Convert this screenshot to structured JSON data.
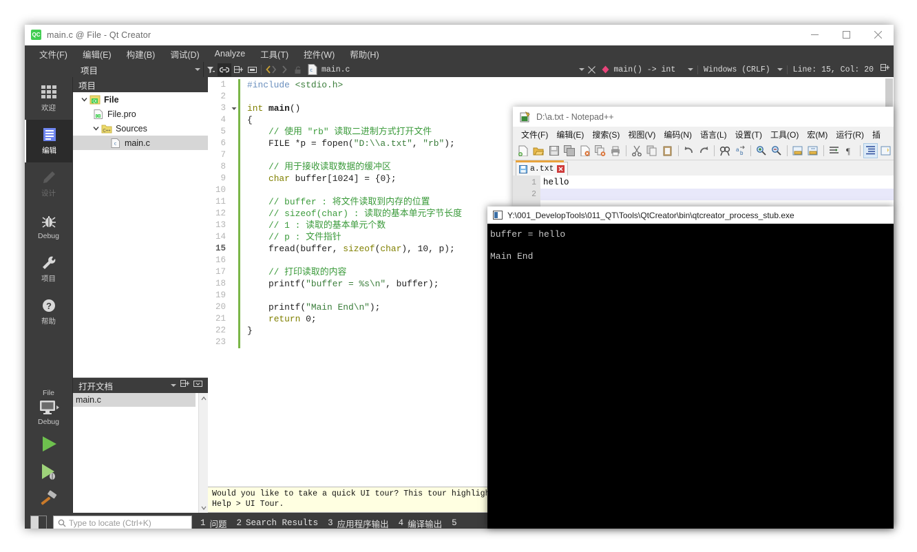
{
  "qtcreator": {
    "title": "main.c @ File - Qt Creator",
    "app_icon": "qt-creator-icon",
    "window_controls": {
      "minimize": "minimize-icon",
      "maximize": "maximize-icon",
      "close": "close-icon"
    },
    "menus": [
      {
        "label": "文件(F)"
      },
      {
        "label": "编辑(E)"
      },
      {
        "label": "构建(B)"
      },
      {
        "label": "调试(D)"
      },
      {
        "label": "Analyze"
      },
      {
        "label": "工具(T)"
      },
      {
        "label": "控件(W)"
      },
      {
        "label": "帮助(H)"
      }
    ],
    "toolbar": {
      "project_combo": "项目",
      "filter_icon": "filter-icon",
      "link_icon": "link-with-editor-icon",
      "split_icon": "add-split-icon",
      "collapse_icon": "collapse-icon",
      "nav_back_icon": "go-back-icon",
      "nav_forward_icon": "go-forward-icon",
      "lock_icon": "unlock-icon",
      "document_name": "main.c",
      "document_icon": "c-file-icon",
      "close_doc_icon": "close-document-icon",
      "symbol_name": "main() -> int",
      "symbol_icon": "function-symbol-icon",
      "eol_setting": "Windows (CRLF)",
      "line_col": "Line: 15, Col: 20",
      "split_editor_icon": "split-editor-icon"
    },
    "modes": [
      {
        "label": "欢迎",
        "icon": "welcome-grid-icon",
        "state": "normal"
      },
      {
        "label": "编辑",
        "icon": "edit-lines-icon",
        "state": "selected"
      },
      {
        "label": "设计",
        "icon": "design-pencil-icon",
        "state": "disabled"
      },
      {
        "label": "Debug",
        "icon": "debug-bug-icon",
        "state": "normal"
      },
      {
        "label": "项目",
        "icon": "projects-wrench-icon",
        "state": "normal"
      },
      {
        "label": "帮助",
        "icon": "help-question-icon",
        "state": "normal"
      }
    ],
    "run_section": {
      "kit_label": "File",
      "target_icon": "target-selector-icon",
      "build_config": "Debug",
      "run_icon": "run-play-icon",
      "debug_icon": "start-debugging-icon",
      "build_icon": "build-hammer-icon"
    },
    "project_dock": {
      "title": "项目",
      "tree": [
        {
          "label": "File",
          "icon": "qt-project-icon",
          "indent": 0,
          "expander": "expanded",
          "bold": true,
          "selected": false
        },
        {
          "label": "File.pro",
          "icon": "qt-pro-file-icon",
          "indent": 1,
          "expander": "none",
          "bold": false,
          "selected": false
        },
        {
          "label": "Sources",
          "icon": "cpp-folder-icon",
          "indent": 1,
          "expander": "expanded",
          "bold": false,
          "selected": false
        },
        {
          "label": "main.c",
          "icon": "c-file-icon",
          "indent": 2,
          "expander": "none",
          "bold": false,
          "selected": true
        }
      ]
    },
    "opendocs_dock": {
      "title": "打开文档",
      "items": [
        {
          "label": "main.c",
          "selected": true
        }
      ]
    },
    "editor": {
      "current_line": 15,
      "total_lines": 23,
      "lines": [
        {
          "n": 1,
          "fold": "none",
          "tokens": [
            {
              "t": "#include ",
              "c": "k-pre"
            },
            {
              "t": "<stdio.h>",
              "c": "k-inc"
            }
          ]
        },
        {
          "n": 2,
          "fold": "none",
          "tokens": []
        },
        {
          "n": 3,
          "fold": "expanded",
          "tokens": [
            {
              "t": "int ",
              "c": "k-type"
            },
            {
              "t": "main",
              "c": "k-fn"
            },
            {
              "t": "()",
              "c": "k-id"
            }
          ]
        },
        {
          "n": 4,
          "fold": "none",
          "tokens": [
            {
              "t": "{",
              "c": "k-id"
            }
          ]
        },
        {
          "n": 5,
          "fold": "none",
          "tokens": [
            {
              "t": "    // 使用 \"rb\" 读取二进制方式打开文件",
              "c": "k-cmt"
            }
          ]
        },
        {
          "n": 6,
          "fold": "none",
          "tokens": [
            {
              "t": "    FILE *p = fopen(",
              "c": "k-id"
            },
            {
              "t": "\"D:\\\\a.txt\"",
              "c": "k-str"
            },
            {
              "t": ", ",
              "c": "k-id"
            },
            {
              "t": "\"rb\"",
              "c": "k-str"
            },
            {
              "t": ");",
              "c": "k-id"
            }
          ]
        },
        {
          "n": 7,
          "fold": "none",
          "tokens": []
        },
        {
          "n": 8,
          "fold": "none",
          "tokens": [
            {
              "t": "    // 用于接收读取数据的缓冲区",
              "c": "k-cmt"
            }
          ]
        },
        {
          "n": 9,
          "fold": "none",
          "tokens": [
            {
              "t": "    ",
              "c": "k-id"
            },
            {
              "t": "char",
              "c": "k-type"
            },
            {
              "t": " buffer[",
              "c": "k-id"
            },
            {
              "t": "1024",
              "c": "k-num"
            },
            {
              "t": "] = {",
              "c": "k-id"
            },
            {
              "t": "0",
              "c": "k-num"
            },
            {
              "t": "};",
              "c": "k-id"
            }
          ]
        },
        {
          "n": 10,
          "fold": "none",
          "tokens": []
        },
        {
          "n": 11,
          "fold": "none",
          "tokens": [
            {
              "t": "    // buffer : 将文件读取到内存的位置",
              "c": "k-cmt"
            }
          ]
        },
        {
          "n": 12,
          "fold": "none",
          "tokens": [
            {
              "t": "    // sizeof(char) : 读取的基本单元字节长度",
              "c": "k-cmt"
            }
          ]
        },
        {
          "n": 13,
          "fold": "none",
          "tokens": [
            {
              "t": "    // 1 : 读取的基本单元个数",
              "c": "k-cmt"
            }
          ]
        },
        {
          "n": 14,
          "fold": "none",
          "tokens": [
            {
              "t": "    // p : 文件指针",
              "c": "k-cmt"
            }
          ]
        },
        {
          "n": 15,
          "fold": "none",
          "tokens": [
            {
              "t": "    fread(buffer, ",
              "c": "k-id"
            },
            {
              "t": "sizeof",
              "c": "k-type"
            },
            {
              "t": "(",
              "c": "k-id"
            },
            {
              "t": "char",
              "c": "k-type"
            },
            {
              "t": "), ",
              "c": "k-id"
            },
            {
              "t": "10",
              "c": "k-num"
            },
            {
              "t": ", p);",
              "c": "k-id"
            }
          ]
        },
        {
          "n": 16,
          "fold": "none",
          "tokens": []
        },
        {
          "n": 17,
          "fold": "none",
          "tokens": [
            {
              "t": "    // 打印读取的内容",
              "c": "k-cmt"
            }
          ]
        },
        {
          "n": 18,
          "fold": "none",
          "tokens": [
            {
              "t": "    printf(",
              "c": "k-id"
            },
            {
              "t": "\"buffer = %s\\n\"",
              "c": "k-str"
            },
            {
              "t": ", buffer);",
              "c": "k-id"
            }
          ]
        },
        {
          "n": 19,
          "fold": "none",
          "tokens": []
        },
        {
          "n": 20,
          "fold": "none",
          "tokens": [
            {
              "t": "    printf(",
              "c": "k-id"
            },
            {
              "t": "\"Main End\\n\"",
              "c": "k-str"
            },
            {
              "t": ");",
              "c": "k-id"
            }
          ]
        },
        {
          "n": 21,
          "fold": "none",
          "tokens": [
            {
              "t": "    ",
              "c": "k-id"
            },
            {
              "t": "return",
              "c": "k-type"
            },
            {
              "t": " ",
              "c": "k-id"
            },
            {
              "t": "0",
              "c": "k-num"
            },
            {
              "t": ";",
              "c": "k-id"
            }
          ]
        },
        {
          "n": 22,
          "fold": "none",
          "tokens": [
            {
              "t": "}",
              "c": "k-id"
            }
          ]
        },
        {
          "n": 23,
          "fold": "none",
          "tokens": []
        }
      ]
    },
    "tour_hint": {
      "line1": "Would you like to take a quick UI tour? This tour highlights important user interface elements and s",
      "line2": "Help > UI Tour."
    },
    "statusbar": {
      "sidebar_toggle_icon": "toggle-sidebar-icon",
      "locate_placeholder": "Type to locate (Ctrl+K)",
      "search_icon": "search-icon",
      "tabs": [
        {
          "num": "1",
          "label": "问题",
          "mono": false
        },
        {
          "num": "2",
          "label": "Search Results",
          "mono": true
        },
        {
          "num": "3",
          "label": "应用程序输出",
          "mono": false
        },
        {
          "num": "4",
          "label": "编译输出",
          "mono": false
        },
        {
          "num": "5",
          "label": "",
          "mono": false
        }
      ]
    }
  },
  "notepadpp": {
    "title": "D:\\a.txt - Notepad++",
    "icon": "notepadpp-icon",
    "menus": [
      {
        "label": "文件(F)"
      },
      {
        "label": "编辑(E)"
      },
      {
        "label": "搜索(S)"
      },
      {
        "label": "视图(V)"
      },
      {
        "label": "编码(N)"
      },
      {
        "label": "语言(L)"
      },
      {
        "label": "设置(T)"
      },
      {
        "label": "工具(O)"
      },
      {
        "label": "宏(M)"
      },
      {
        "label": "运行(R)"
      },
      {
        "label": "插"
      }
    ],
    "toolbar_icons": [
      "new-file-icon",
      "open-file-icon",
      "save-icon",
      "save-all-icon",
      "close-file-icon",
      "close-all-icon",
      "print-icon",
      "sep",
      "cut-icon",
      "copy-icon",
      "paste-icon",
      "sep",
      "undo-icon",
      "redo-icon",
      "sep",
      "find-icon",
      "replace-icon",
      "sep",
      "zoom-in-icon",
      "zoom-out-icon",
      "sep",
      "sync-scroll-v-icon",
      "sync-scroll-h-icon",
      "sep",
      "word-wrap-icon",
      "show-all-chars-icon",
      "sep",
      "indent-guide-icon",
      "ui-sheet-icon"
    ],
    "tab": {
      "label": "a.txt",
      "icon": "saved-file-icon",
      "close_icon": "tab-close-icon"
    },
    "document_lines": [
      {
        "n": 1,
        "text": "hello",
        "highlight": false
      },
      {
        "n": 2,
        "text": "",
        "highlight": true
      }
    ]
  },
  "console": {
    "title": "Y:\\001_DevelopTools\\011_QT\\Tools\\QtCreator\\bin\\qtcreator_process_stub.exe",
    "icon": "console-window-icon",
    "lines": [
      "buffer = hello",
      "",
      "Main End"
    ]
  },
  "colors": {
    "qt_chrome": "#3c3c3c",
    "qt_chrome_dark": "#2b2b2b",
    "accent_green": "#41cd52",
    "comment_green": "#3a9a3a",
    "string_green": "#3a7d3a",
    "type_olive": "#808000",
    "preproc_blue": "#6a8fbe",
    "tour_yellow": "#ffffe1",
    "npp_tab_orange": "#e8a33d",
    "console_bg": "#000000"
  }
}
